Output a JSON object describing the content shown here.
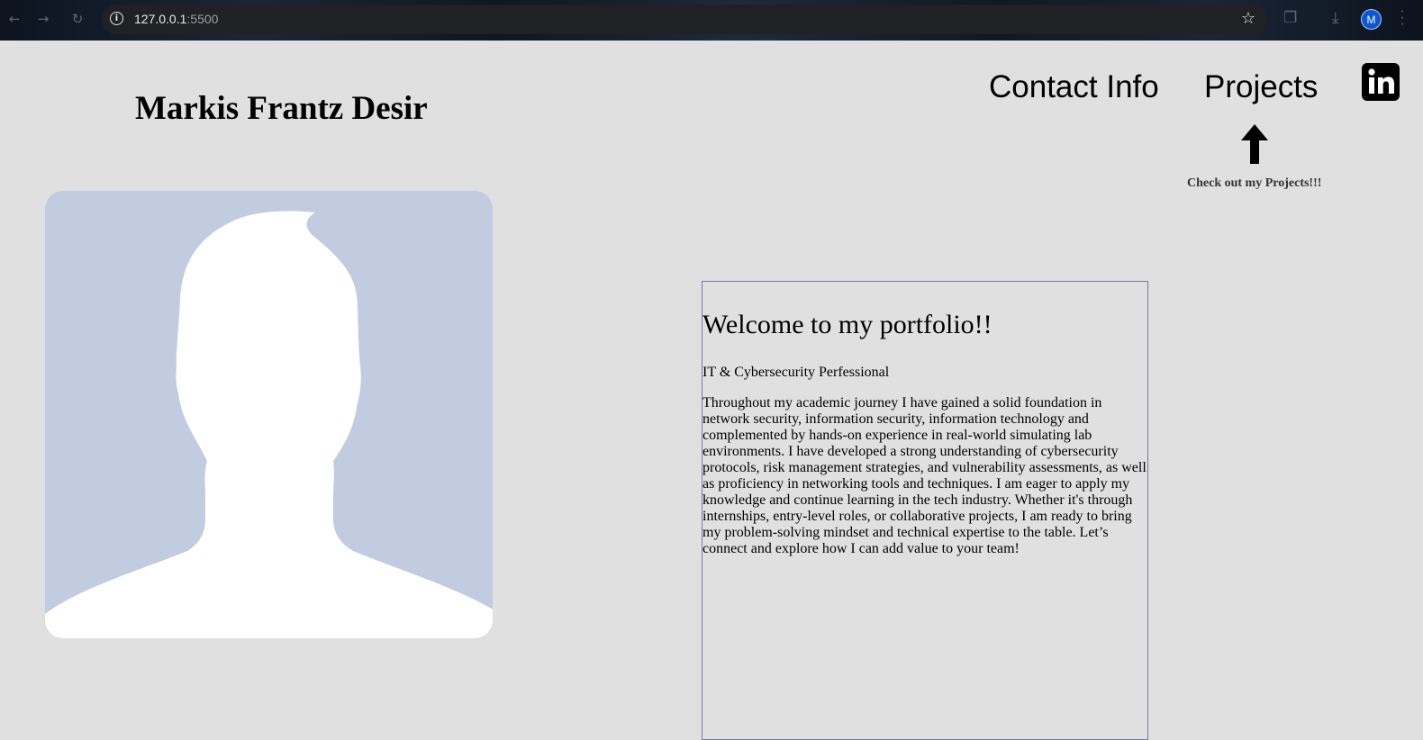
{
  "browser": {
    "url_host": "127.0.0.1",
    "url_port": ":5500",
    "profile_initial": "M",
    "icons": [
      "back-icon",
      "forward-icon",
      "reload-icon",
      "info-icon",
      "star-icon",
      "extensions-icon",
      "download-icon",
      "menu-icon"
    ]
  },
  "header": {
    "name": "Markis Frantz Desir",
    "nav": [
      {
        "label": "Contact Info"
      },
      {
        "label": "Projects"
      }
    ],
    "social_icon": "linkedin-icon",
    "projects_hint": "Check out my Projects!!!"
  },
  "about": {
    "title": "Welcome to my portfolio!!",
    "subtitle": "IT & Cybersecurity Perfessional",
    "body": "Throughout my academic journey I have gained a solid foundation in network security, information security, information technology and complemented by hands-on experience in real-world simulating lab environments. I have developed a strong understanding of cybersecurity protocols, risk management strategies, and vulnerability assessments, as well as proficiency in networking tools and techniques. I am eager to apply my knowledge and continue learning in the tech industry. Whether it's through internships, entry-level roles, or collaborative projects, I am ready to bring my problem-solving mindset and technical expertise to the table. Let’s connect and explore how I can add value to your team!"
  },
  "colors": {
    "page_background": "#e0e0e0",
    "photo_background": "#c2cce0",
    "box_border": "#7a7aa0"
  }
}
